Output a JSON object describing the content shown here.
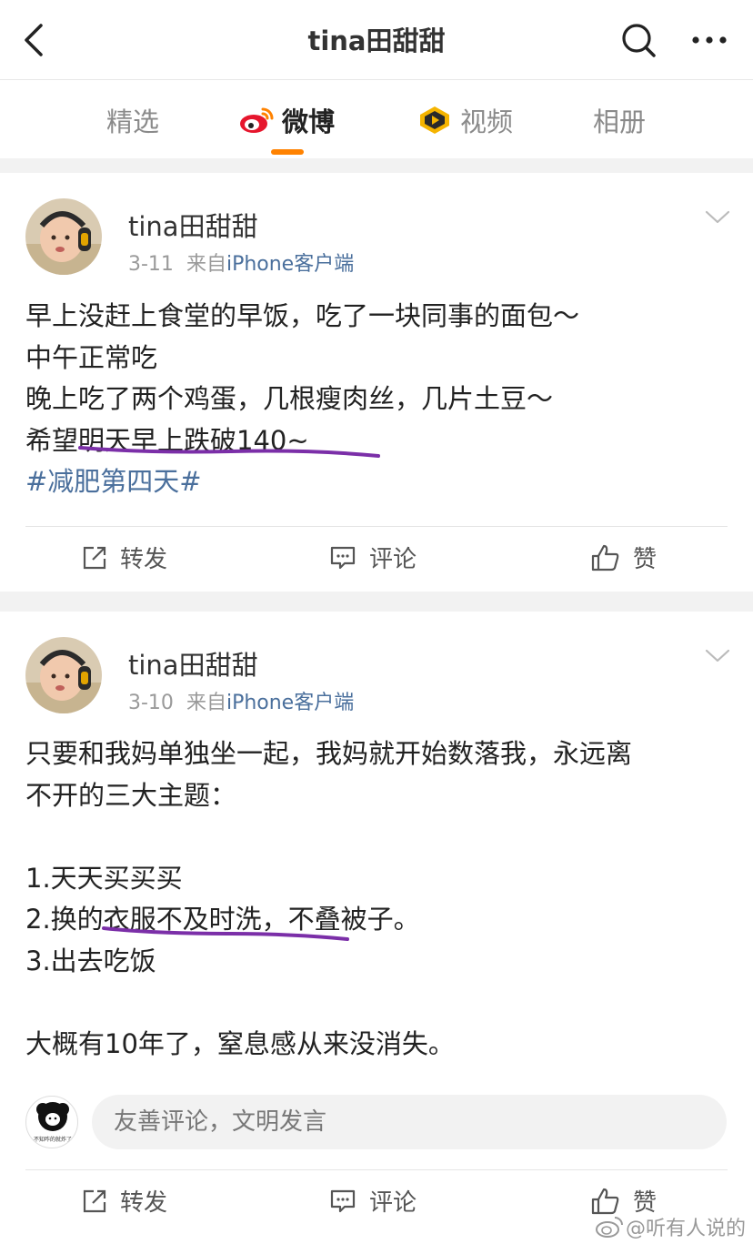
{
  "header": {
    "title": "tina田甜甜"
  },
  "tabs": [
    {
      "label": "精选"
    },
    {
      "label": "微博"
    },
    {
      "label": "视频"
    },
    {
      "label": "相册"
    }
  ],
  "posts": [
    {
      "username": "tina田甜甜",
      "date": "3-11",
      "source_prefix": "来自",
      "source_link": "iPhone客户端",
      "lines": [
        "早上没赶上食堂的早饭，吃了一块同事的面包～",
        "中午正常吃",
        "晚上吃了两个鸡蛋，几根瘦肉丝，几片土豆～",
        "希望明天早上跌破140~"
      ],
      "hashtag": "#减肥第四天#",
      "actions": {
        "repost": "转发",
        "comment": "评论",
        "like": "赞"
      }
    },
    {
      "username": "tina田甜甜",
      "date": "3-10",
      "source_prefix": "来自",
      "source_link": "iPhone客户端",
      "lines": [
        "只要和我妈单独坐一起，我妈就开始数落我，永远离",
        "不开的三大主题：",
        "",
        "1.天天买买买",
        "2.换的衣服不及时洗，不叠被子。",
        "3.出去吃饭",
        "",
        "大概有10年了，窒息感从来没消失。"
      ],
      "comment_placeholder": "友善评论，文明发言",
      "commenter_avatar_text": "不知咋的就炸了",
      "actions": {
        "repost": "转发",
        "comment": "评论",
        "like": "赞"
      }
    }
  ],
  "watermark": {
    "text": "@听有人说的"
  },
  "colors": {
    "accent": "#ff8200",
    "link": "#4a6f9c",
    "annotation": "#7b2fa8"
  }
}
